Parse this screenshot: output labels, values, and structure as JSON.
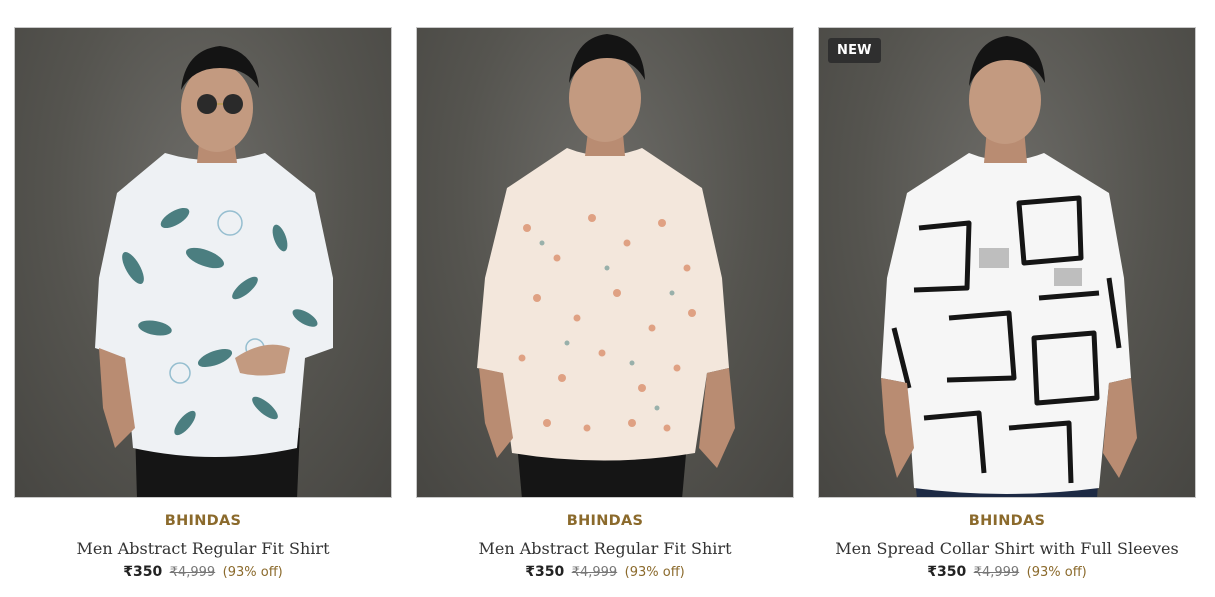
{
  "products": [
    {
      "badge": "",
      "brand": "BHINDAS",
      "title": "Men Abstract Regular Fit Shirt",
      "price": "₹350",
      "mrp": "₹4,999",
      "discount": "(93% off)",
      "image_icon": "model-shirt-blue-floral-icon"
    },
    {
      "badge": "",
      "brand": "BHINDAS",
      "title": "Men Abstract Regular Fit Shirt",
      "price": "₹350",
      "mrp": "₹4,999",
      "discount": "(93% off)",
      "image_icon": "model-shirt-peach-floral-icon"
    },
    {
      "badge": "NEW",
      "brand": "BHINDAS",
      "title": "Men Spread Collar Shirt with Full Sleeves",
      "price": "₹350",
      "mrp": "₹4,999",
      "discount": "(93% off)",
      "image_icon": "model-shirt-black-white-abstract-icon"
    }
  ],
  "colors": {
    "brand": "#8b6a2c",
    "badge_bg": "#2f2f2f",
    "photo_bg": "#55544f"
  }
}
